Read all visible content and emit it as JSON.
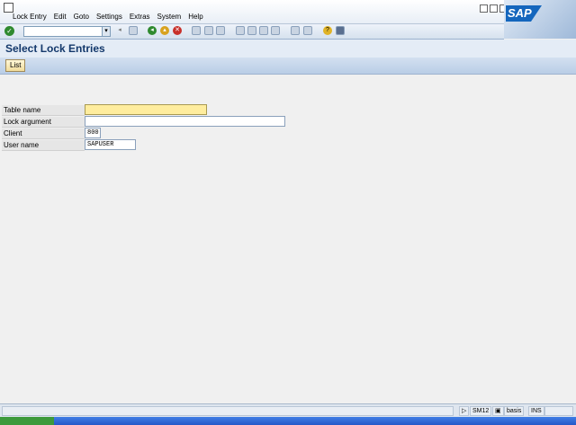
{
  "menu": {
    "items": [
      "Lock Entry",
      "Edit",
      "Goto",
      "Settings",
      "Extras",
      "System",
      "Help"
    ]
  },
  "logo": {
    "text": "SAP"
  },
  "toolbar": {
    "command_value": "",
    "icons": [
      "enter-icon",
      "back-icon",
      "exit-icon",
      "cancel-icon",
      "print-icon",
      "find-icon",
      "find-next-icon",
      "first-page-icon",
      "previous-page-icon",
      "next-page-icon",
      "last-page-icon",
      "create-session-icon",
      "shortcut-icon",
      "help-icon",
      "layout-icon"
    ]
  },
  "title": {
    "text": "Select Lock Entries"
  },
  "app_toolbar": {
    "list_label": "List"
  },
  "form": {
    "table_name": {
      "label": "Table name",
      "value": ""
    },
    "lock_argument": {
      "label": "Lock argument",
      "value": ""
    },
    "client": {
      "label": "Client",
      "value": "800"
    },
    "user_name": {
      "label": "User name",
      "value": "SAPUSER"
    }
  },
  "status": {
    "transaction": "SM12",
    "server": "basis",
    "mode": "INS"
  },
  "colors": {
    "title_text": "#13386b",
    "focused_field": "#ffed9e",
    "sap_blue": "#1466bd"
  }
}
